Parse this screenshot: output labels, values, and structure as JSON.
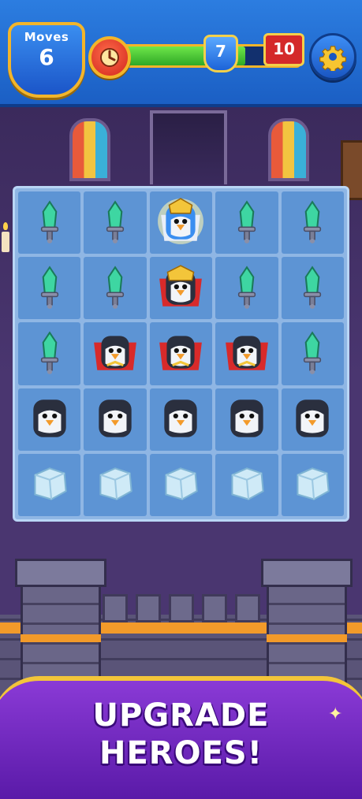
{
  "hud": {
    "moves_label": "Moves",
    "moves_value": "6",
    "progress_current": "7",
    "progress_goal": "10",
    "progress_fraction": 0.7,
    "clock_icon": "clock-icon",
    "settings_icon": "gear-icon"
  },
  "board": {
    "rows": [
      [
        "sword",
        "sword",
        "hero-blue",
        "sword",
        "sword"
      ],
      [
        "sword",
        "sword",
        "hero-red",
        "sword",
        "sword"
      ],
      [
        "sword",
        "penguin-caped",
        "penguin-caped",
        "penguin-caped",
        "sword"
      ],
      [
        "penguin",
        "penguin",
        "penguin",
        "penguin",
        "penguin"
      ],
      [
        "ice",
        "ice",
        "ice",
        "ice",
        "ice"
      ]
    ]
  },
  "banner": {
    "line1": "UPGRADE",
    "line2": "HEROES!"
  },
  "colors": {
    "hud_blue": "#1b5fc4",
    "gold": "#f3b52a",
    "progress_green": "#2fa826",
    "goal_red": "#d42a2a",
    "banner_purple": "#6a24b8"
  }
}
